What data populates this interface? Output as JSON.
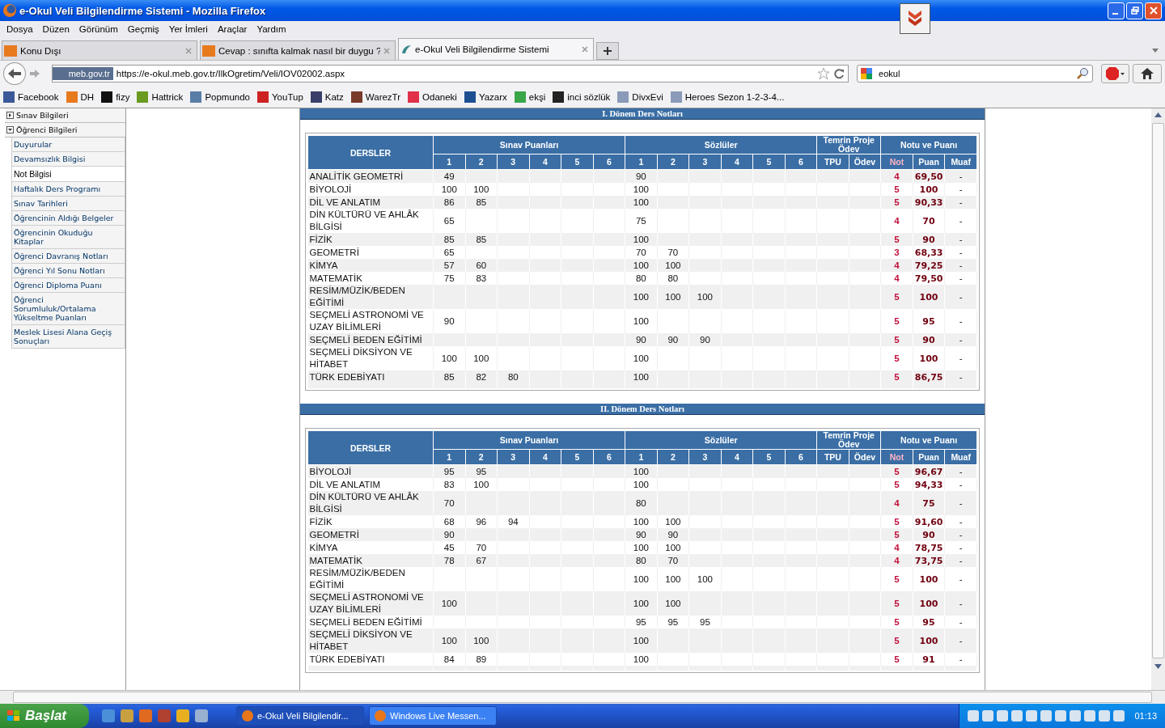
{
  "window": {
    "title": "e-Okul Veli Bilgilendirme Sistemi - Mozilla Firefox"
  },
  "menu": [
    "Dosya",
    "Düzen",
    "Görünüm",
    "Geçmiş",
    "Yer İmleri",
    "Araçlar",
    "Yardım"
  ],
  "tabs": [
    {
      "label": "Konu Dışı",
      "selected": false,
      "kind": "dh"
    },
    {
      "label": "Cevap : sınıfta kalmak nasıl bir duygu ?",
      "selected": false,
      "kind": "dh"
    },
    {
      "label": "e-Okul Veli Bilgilendirme Sistemi",
      "selected": true,
      "kind": "eokul"
    }
  ],
  "address": {
    "site": "meb.gov.tr",
    "url": "https://e-okul.meb.gov.tr/IlkOgretim/Veli/IOV02002.aspx"
  },
  "search": {
    "value": "eokul"
  },
  "bookmarks": [
    {
      "label": "Facebook",
      "color": "#3b5998"
    },
    {
      "label": "DH",
      "color": "#e87a1e"
    },
    {
      "label": "fizy",
      "color": "#111111"
    },
    {
      "label": "Hattrick",
      "color": "#6a9a1f"
    },
    {
      "label": "Popmundo",
      "color": "#5a7da8"
    },
    {
      "label": "YouTup",
      "color": "#cc2222"
    },
    {
      "label": "Katz",
      "color": "#3a3f6a"
    },
    {
      "label": "WarezTr",
      "color": "#7a3a2a"
    },
    {
      "label": "Odaneki",
      "color": "#e0304a"
    },
    {
      "label": "Yazarx",
      "color": "#1d4f91"
    },
    {
      "label": "ekşi",
      "color": "#3aa64a"
    },
    {
      "label": "inci sözlük",
      "color": "#222222"
    },
    {
      "label": "DivxEvi",
      "color": "#8a9ab8"
    },
    {
      "label": "Heroes Sezon 1-2-3-4...",
      "color": "#8a9ab8"
    }
  ],
  "sidebar": {
    "items": [
      {
        "label": "Sınav Bilgileri",
        "expanded": false
      },
      {
        "label": "Öğrenci Bilgileri",
        "expanded": true,
        "children": [
          {
            "label": "Duyurular",
            "selected": false
          },
          {
            "label": "Devamsızlık Bilgisi",
            "selected": false
          },
          {
            "label": "Not Bilgisi",
            "selected": true
          },
          {
            "label": "Haftalık Ders Programı",
            "selected": false
          },
          {
            "label": "Sınav Tarihleri",
            "selected": false
          },
          {
            "label": "Öğrencinin Aldığı Belgeler",
            "selected": false
          },
          {
            "label": "Öğrencinin Okuduğu Kitaplar",
            "selected": false
          },
          {
            "label": "Öğrenci Davranış Notları",
            "selected": false
          },
          {
            "label": "Öğrenci Yıl Sonu Notları",
            "selected": false
          },
          {
            "label": "Öğrenci Diploma Puanı",
            "selected": false
          },
          {
            "label": "Öğrenci Sorumluluk/Ortalama Yükseltme Puanları",
            "selected": false
          },
          {
            "label": "Meslek Lisesi Alana Geçiş Sonuçları",
            "selected": false
          }
        ]
      }
    ]
  },
  "semesters": [
    {
      "title": "I. Dönem Ders Notları",
      "header": {
        "subject": "DERSLER",
        "exams": "Sınav Puanları",
        "orals": "Sözlüler",
        "projects": "Temrin Proje Ödev",
        "result": "Notu ve Puanı",
        "exam_numbers": [
          "1",
          "2",
          "3",
          "4",
          "5",
          "6"
        ],
        "oral_numbers": [
          "1",
          "2",
          "3",
          "4",
          "5",
          "6"
        ],
        "tpu": "TPU",
        "odev": "Ödev",
        "not": "Not",
        "puan": "Puan",
        "muaf": "Muaf"
      },
      "rows": [
        {
          "subject": "ANALİTİK GEOMETRİ",
          "exams": [
            "49"
          ],
          "orals": [
            "90"
          ],
          "not": "4",
          "puan": "69,50",
          "muaf": "-"
        },
        {
          "subject": "BİYOLOJİ",
          "exams": [
            "100",
            "100"
          ],
          "orals": [
            "100"
          ],
          "not": "5",
          "puan": "100",
          "muaf": "-"
        },
        {
          "subject": "DİL VE ANLATIM",
          "exams": [
            "86",
            "85"
          ],
          "orals": [
            "100"
          ],
          "not": "5",
          "puan": "90,33",
          "muaf": "-"
        },
        {
          "subject": "DİN KÜLTÜRÜ VE AHLÂK BİLGİSİ",
          "exams": [
            "65"
          ],
          "orals": [
            "75"
          ],
          "not": "4",
          "puan": "70",
          "muaf": "-"
        },
        {
          "subject": "FİZİK",
          "exams": [
            "85",
            "85"
          ],
          "orals": [
            "100"
          ],
          "not": "5",
          "puan": "90",
          "muaf": "-"
        },
        {
          "subject": "GEOMETRİ",
          "exams": [
            "65"
          ],
          "orals": [
            "70",
            "70"
          ],
          "not": "3",
          "puan": "68,33",
          "muaf": "-"
        },
        {
          "subject": "KİMYA",
          "exams": [
            "57",
            "60"
          ],
          "orals": [
            "100",
            "100"
          ],
          "not": "4",
          "puan": "79,25",
          "muaf": "-"
        },
        {
          "subject": "MATEMATİK",
          "exams": [
            "75",
            "83"
          ],
          "orals": [
            "80",
            "80"
          ],
          "not": "4",
          "puan": "79,50",
          "muaf": "-"
        },
        {
          "subject": "RESİM/MÜZİK/BEDEN EĞİTİMİ",
          "exams": [],
          "orals": [
            "100",
            "100",
            "100"
          ],
          "not": "5",
          "puan": "100",
          "muaf": "-"
        },
        {
          "subject": "SEÇMELİ ASTRONOMİ VE UZAY BİLİMLERİ",
          "exams": [
            "90"
          ],
          "orals": [
            "100"
          ],
          "not": "5",
          "puan": "95",
          "muaf": "-"
        },
        {
          "subject": "SEÇMELİ BEDEN EĞİTİMİ",
          "exams": [],
          "orals": [
            "90",
            "90",
            "90"
          ],
          "not": "5",
          "puan": "90",
          "muaf": "-"
        },
        {
          "subject": "SEÇMELİ DİKSİYON VE HİTABET",
          "exams": [
            "100",
            "100"
          ],
          "orals": [
            "100"
          ],
          "not": "5",
          "puan": "100",
          "muaf": "-"
        },
        {
          "subject": "TÜRK EDEBİYATI",
          "exams": [
            "85",
            "82",
            "80"
          ],
          "orals": [
            "100"
          ],
          "not": "5",
          "puan": "86,75",
          "muaf": "-"
        }
      ]
    },
    {
      "title": "II. Dönem Ders Notları",
      "header": {
        "subject": "DERSLER",
        "exams": "Sınav Puanları",
        "orals": "Sözlüler",
        "projects": "Temrin Proje Ödev",
        "result": "Notu ve Puanı",
        "exam_numbers": [
          "1",
          "2",
          "3",
          "4",
          "5",
          "6"
        ],
        "oral_numbers": [
          "1",
          "2",
          "3",
          "4",
          "5",
          "6"
        ],
        "tpu": "TPU",
        "odev": "Ödev",
        "not": "Not",
        "puan": "Puan",
        "muaf": "Muaf"
      },
      "rows": [
        {
          "subject": "BİYOLOJİ",
          "exams": [
            "95",
            "95"
          ],
          "orals": [
            "100"
          ],
          "not": "5",
          "puan": "96,67",
          "muaf": "-"
        },
        {
          "subject": "DİL VE ANLATIM",
          "exams": [
            "83",
            "100"
          ],
          "orals": [
            "100"
          ],
          "not": "5",
          "puan": "94,33",
          "muaf": "-"
        },
        {
          "subject": "DİN KÜLTÜRÜ VE AHLÂK BİLGİSİ",
          "exams": [
            "70"
          ],
          "orals": [
            "80"
          ],
          "not": "4",
          "puan": "75",
          "muaf": "-"
        },
        {
          "subject": "FİZİK",
          "exams": [
            "68",
            "96",
            "94"
          ],
          "orals": [
            "100",
            "100"
          ],
          "not": "5",
          "puan": "91,60",
          "muaf": "-"
        },
        {
          "subject": "GEOMETRİ",
          "exams": [
            "90"
          ],
          "orals": [
            "90",
            "90"
          ],
          "not": "5",
          "puan": "90",
          "muaf": "-"
        },
        {
          "subject": "KİMYA",
          "exams": [
            "45",
            "70"
          ],
          "orals": [
            "100",
            "100"
          ],
          "not": "4",
          "puan": "78,75",
          "muaf": "-"
        },
        {
          "subject": "MATEMATİK",
          "exams": [
            "78",
            "67"
          ],
          "orals": [
            "80",
            "70"
          ],
          "not": "4",
          "puan": "73,75",
          "muaf": "-"
        },
        {
          "subject": "RESİM/MÜZİK/BEDEN EĞİTİMİ",
          "exams": [],
          "orals": [
            "100",
            "100",
            "100"
          ],
          "not": "5",
          "puan": "100",
          "muaf": "-"
        },
        {
          "subject": "SEÇMELİ ASTRONOMİ VE UZAY BİLİMLERİ",
          "exams": [
            "100"
          ],
          "orals": [
            "100",
            "100"
          ],
          "not": "5",
          "puan": "100",
          "muaf": "-"
        },
        {
          "subject": "SEÇMELİ BEDEN EĞİTİMİ",
          "exams": [],
          "orals": [
            "95",
            "95",
            "95"
          ],
          "not": "5",
          "puan": "95",
          "muaf": "-"
        },
        {
          "subject": "SEÇMELİ DİKSİYON VE HİTABET",
          "exams": [
            "100",
            "100"
          ],
          "orals": [
            "100"
          ],
          "not": "5",
          "puan": "100",
          "muaf": "-"
        },
        {
          "subject": "TÜRK EDEBİYATI",
          "exams": [
            "84",
            "89"
          ],
          "orals": [
            "100"
          ],
          "not": "5",
          "puan": "91",
          "muaf": "-"
        }
      ]
    }
  ],
  "taskbar": {
    "start": "Başlat",
    "tasks": [
      {
        "label": "e-Okul Veli Bilgilendir...",
        "selected": true
      },
      {
        "label": "Windows Live Messen...",
        "selected": false
      }
    ],
    "clock": "01:13"
  }
}
